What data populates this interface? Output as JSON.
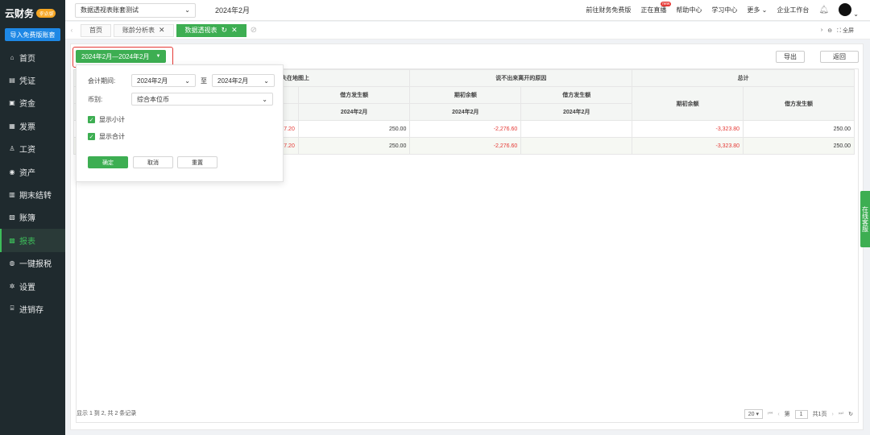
{
  "app": {
    "logo": "云财务",
    "badge": "专业版",
    "import_button": "导入免费版账套"
  },
  "sidebar": {
    "items": [
      {
        "label": "首页",
        "icon": "home-icon",
        "glyph": "⌂"
      },
      {
        "label": "凭证",
        "icon": "voucher-icon",
        "glyph": "▤"
      },
      {
        "label": "资金",
        "icon": "fund-icon",
        "glyph": "▣"
      },
      {
        "label": "发票",
        "icon": "invoice-icon",
        "glyph": "▦"
      },
      {
        "label": "工资",
        "icon": "salary-icon",
        "glyph": "♙"
      },
      {
        "label": "资产",
        "icon": "asset-icon",
        "glyph": "◉"
      },
      {
        "label": "期末结转",
        "icon": "period-close-icon",
        "glyph": "▥"
      },
      {
        "label": "账簿",
        "icon": "ledger-icon",
        "glyph": "▧"
      },
      {
        "label": "报表",
        "icon": "report-icon",
        "glyph": "▩",
        "active": true
      },
      {
        "label": "一键报税",
        "icon": "tax-icon",
        "glyph": "◍"
      },
      {
        "label": "设置",
        "icon": "settings-icon",
        "glyph": "✲"
      },
      {
        "label": "进销存",
        "icon": "inventory-icon",
        "glyph": "⌸"
      }
    ]
  },
  "topbar": {
    "account": "数据透视表账套测试",
    "period": "2024年2月",
    "links": [
      "前往财务免费版",
      "正在直播",
      "帮助中心",
      "学习中心",
      "更多"
    ],
    "live_badge": "new",
    "workbench": "企业工作台"
  },
  "tabs": {
    "items": [
      {
        "label": "首页"
      },
      {
        "label": "账龄分析表"
      },
      {
        "label": "数据透视表",
        "active": true
      }
    ],
    "fullscreen": "全屏"
  },
  "toolbar": {
    "date_range": "2024年2月—2024年2月",
    "export": "导出",
    "back": "返回"
  },
  "table": {
    "group_headers": [
      "迷失在地图上",
      "说不出来离开的原因",
      "总计"
    ],
    "sub_headers": [
      "借方发生额",
      "期初余额",
      "借方发生额",
      "期初余额",
      "借方发生额"
    ],
    "period_header": "2024年2月",
    "rows": [
      [
        "7.20",
        "250.00",
        "-2,276.60",
        "",
        "-3,323.80",
        "250.00"
      ],
      [
        "7.20",
        "250.00",
        "-2,276.60",
        "",
        "-3,323.80",
        "250.00"
      ]
    ],
    "footer": "显示 1 到 2, 共 2 条记录",
    "pager": {
      "page_size": "20",
      "page_label": "第",
      "page": "1",
      "total_pages": "共1页"
    }
  },
  "filter": {
    "period_label": "会计期间:",
    "period_from": "2024年2月",
    "to_label": "至",
    "period_to": "2024年2月",
    "currency_label": "币别:",
    "currency": "综合本位币",
    "show_subtotal": "显示小计",
    "show_total": "显示合计",
    "ok": "确定",
    "cancel": "取消",
    "reset": "重置"
  },
  "service": "在线客服",
  "colors": {
    "brand_green": "#3dae52",
    "sidebar_bg": "#1f2a2e",
    "negative": "#e53935",
    "import_blue": "#1e88e5"
  }
}
